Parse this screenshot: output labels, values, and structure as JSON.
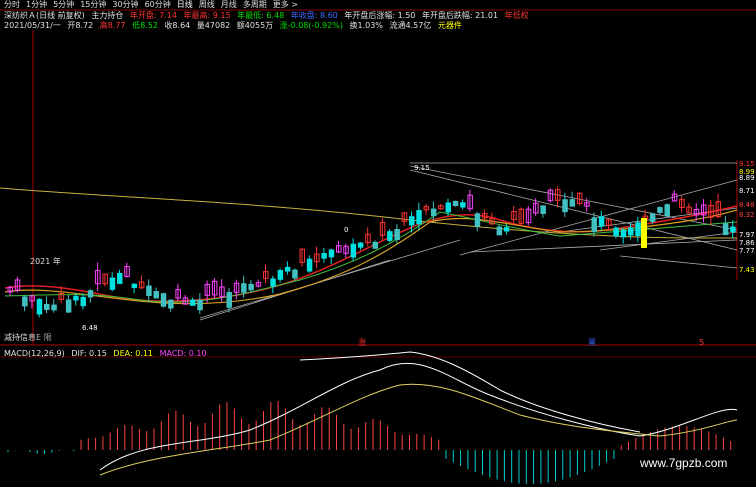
{
  "toolbar": [
    "分时",
    "1分钟",
    "5分钟",
    "15分钟",
    "30分钟",
    "60分钟",
    "日线",
    "周线",
    "月线",
    "多周期",
    "更多 >"
  ],
  "info_line1": {
    "stock": "深纺织Ａ(日线 前复权)",
    "indicator": "主力持仓",
    "open_max_label": "年开盘: 7.14",
    "year_high_label": "年最高: 9.15",
    "year_low_label": "年最低: 6.48",
    "year_close_label": "年收盘: 8.60",
    "year_change_label": "年开盘后涨幅: 1.50",
    "year_change2_label": "年开盘后跌幅: 21.01",
    "year_pos_label": "年低权"
  },
  "info_line2": {
    "date": "2021/05/31/一",
    "open": "开8.72",
    "high": "高8.77",
    "low": "低8.52",
    "close": "收8.64",
    "volume": "量47082",
    "amount": "额4055万",
    "change": "涨-0.08(-0.92%)",
    "turnover": "换1.03%",
    "float_cap": "流通4.57亿",
    "tag": "元器件"
  },
  "price_labels": [
    "9.15",
    "8.99",
    "8.89",
    "8.71",
    "8.48",
    "8.32",
    "7.97",
    "7.86",
    "7.77",
    "7.43"
  ],
  "candle_annotations": {
    "low_mark": "6.48",
    "high_mark": "9.15",
    "year_mark": "2021 年",
    "small_mark": "0"
  },
  "hold_label": "减持信息",
  "hold_sub": "E 限",
  "markers": [
    "涨",
    "黑",
    "5"
  ],
  "macd": {
    "title": "MACD(12,26,9)",
    "dif": "DIF: 0.15",
    "dea": "DEA: 0.11",
    "macd": "MACD: 0.10"
  },
  "watermark": "www.7gpzb.com",
  "colors": {
    "up": "#ff3333",
    "down": "#00e0e0",
    "magenta": "#ff44ff",
    "yellow": "#ffff00",
    "ma_red": "#e02020",
    "ma_gold": "#d4a020"
  }
}
